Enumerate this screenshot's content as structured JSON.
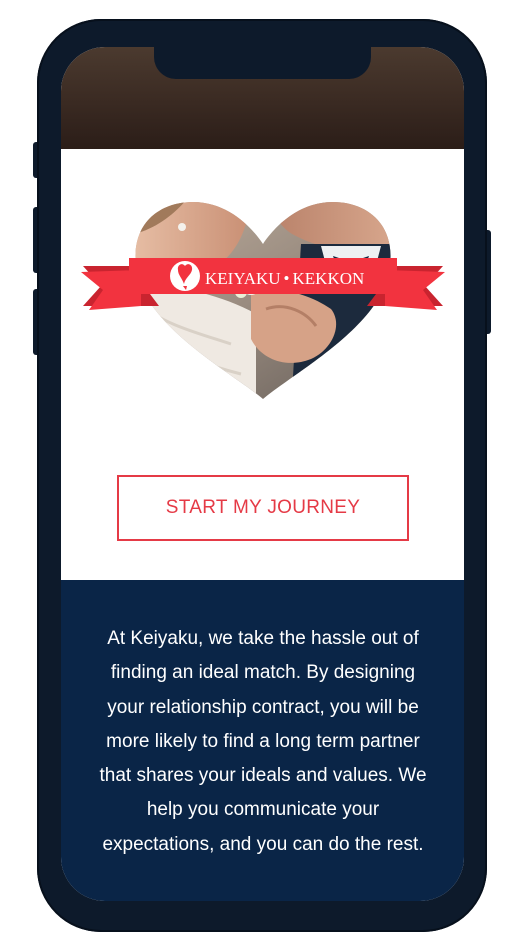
{
  "brand": {
    "name_left": "KEIYAKU",
    "separator": "•",
    "name_right": "KEKKON",
    "ribbon_color": "#f2333f",
    "accent_color": "#e53a46"
  },
  "hero": {
    "image": "couple-kiss-photo"
  },
  "cta": {
    "label": "START MY JOURNEY"
  },
  "about": {
    "text": "At Keiyaku, we take the hassle out of finding an ideal match. By designing your relationship contract, you will be more likely to find a long term partner that shares your ideals and values. We help you communicate your expectations, and you can do the rest."
  },
  "colors": {
    "navy": "#0a2547",
    "phone_frame": "#0d1a2b"
  }
}
